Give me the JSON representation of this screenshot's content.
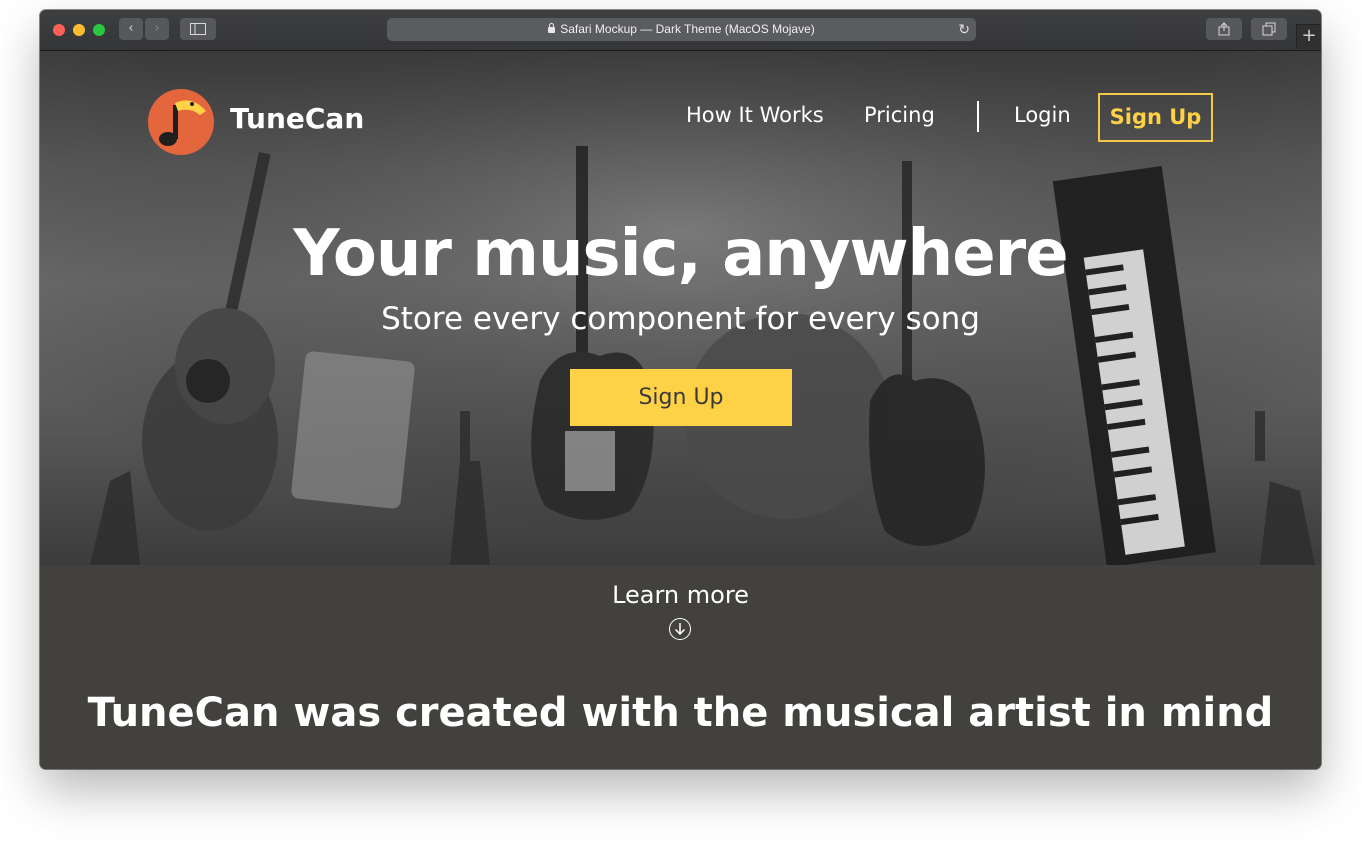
{
  "browser": {
    "url_title": "Safari Mockup — Dark Theme (MacOS Mojave)",
    "icons": [
      "close-light",
      "minimize-light",
      "zoom-light",
      "back-icon",
      "forward-icon",
      "sidebar-icon",
      "lock-icon",
      "reload-icon",
      "share-icon",
      "tabs-icon",
      "new-tab-icon"
    ],
    "colors": {
      "close": "#fe5f57",
      "minimize": "#febc2e",
      "zoom": "#28c840"
    }
  },
  "header": {
    "brand": "TuneCan",
    "nav": [
      "How It Works",
      "Pricing",
      "Login"
    ],
    "signup_label": "Sign Up"
  },
  "hero": {
    "title": "Your music, anywhere",
    "subtitle": "Store every component for every song",
    "cta_label": "Sign Up"
  },
  "lower": {
    "learn_more": "Learn more",
    "section_title": "TuneCan was created with the musical artist in mind"
  },
  "colors": {
    "accent": "#ffd147",
    "logo": "#e4663d",
    "band": "#42413d"
  }
}
